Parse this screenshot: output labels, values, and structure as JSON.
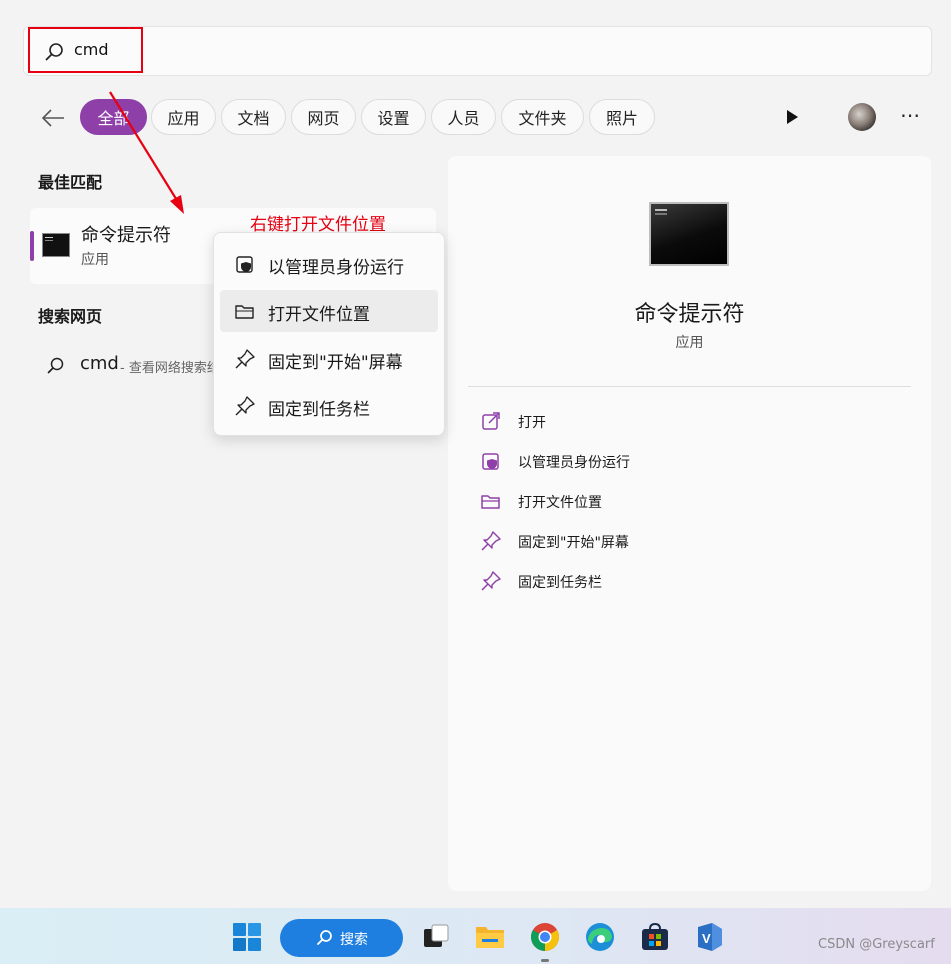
{
  "search": {
    "query": "cmd"
  },
  "filters": {
    "chips": [
      {
        "label": "全部",
        "active": true
      },
      {
        "label": "应用"
      },
      {
        "label": "文档"
      },
      {
        "label": "网页"
      },
      {
        "label": "设置"
      },
      {
        "label": "人员"
      },
      {
        "label": "文件夹"
      },
      {
        "label": "照片"
      }
    ]
  },
  "best_match": {
    "section_title": "最佳匹配",
    "name": "命令提示符",
    "type": "应用"
  },
  "annotation": {
    "text": "右键打开文件位置",
    "color": "#e60012"
  },
  "web_search": {
    "section_title": "搜索网页",
    "query": "cmd",
    "description": "- 查看网络搜索结果"
  },
  "context_menu": {
    "items": [
      {
        "label": "以管理员身份运行",
        "icon": "shield-icon"
      },
      {
        "label": "打开文件位置",
        "icon": "folder-icon",
        "hovered": true
      },
      {
        "label": "固定到\"开始\"屏幕",
        "icon": "pin-icon"
      },
      {
        "label": "固定到任务栏",
        "icon": "pin-icon"
      }
    ]
  },
  "detail": {
    "name": "命令提示符",
    "type": "应用",
    "actions": [
      {
        "label": "打开",
        "icon": "open-external-icon"
      },
      {
        "label": "以管理员身份运行",
        "icon": "shield-icon"
      },
      {
        "label": "打开文件位置",
        "icon": "folder-icon"
      },
      {
        "label": "固定到\"开始\"屏幕",
        "icon": "pin-icon"
      },
      {
        "label": "固定到任务栏",
        "icon": "pin-icon"
      }
    ]
  },
  "taskbar": {
    "search_label": "搜索",
    "apps": [
      "task-view-icon",
      "file-explorer-icon",
      "chrome-icon",
      "edge-icon",
      "store-icon",
      "visual-studio-icon"
    ]
  },
  "watermark": "CSDN @Greyscarf",
  "colors": {
    "accent": "#8e3fa8",
    "annotation_red": "#e60012",
    "taskbar_search": "#1e7fe0"
  }
}
